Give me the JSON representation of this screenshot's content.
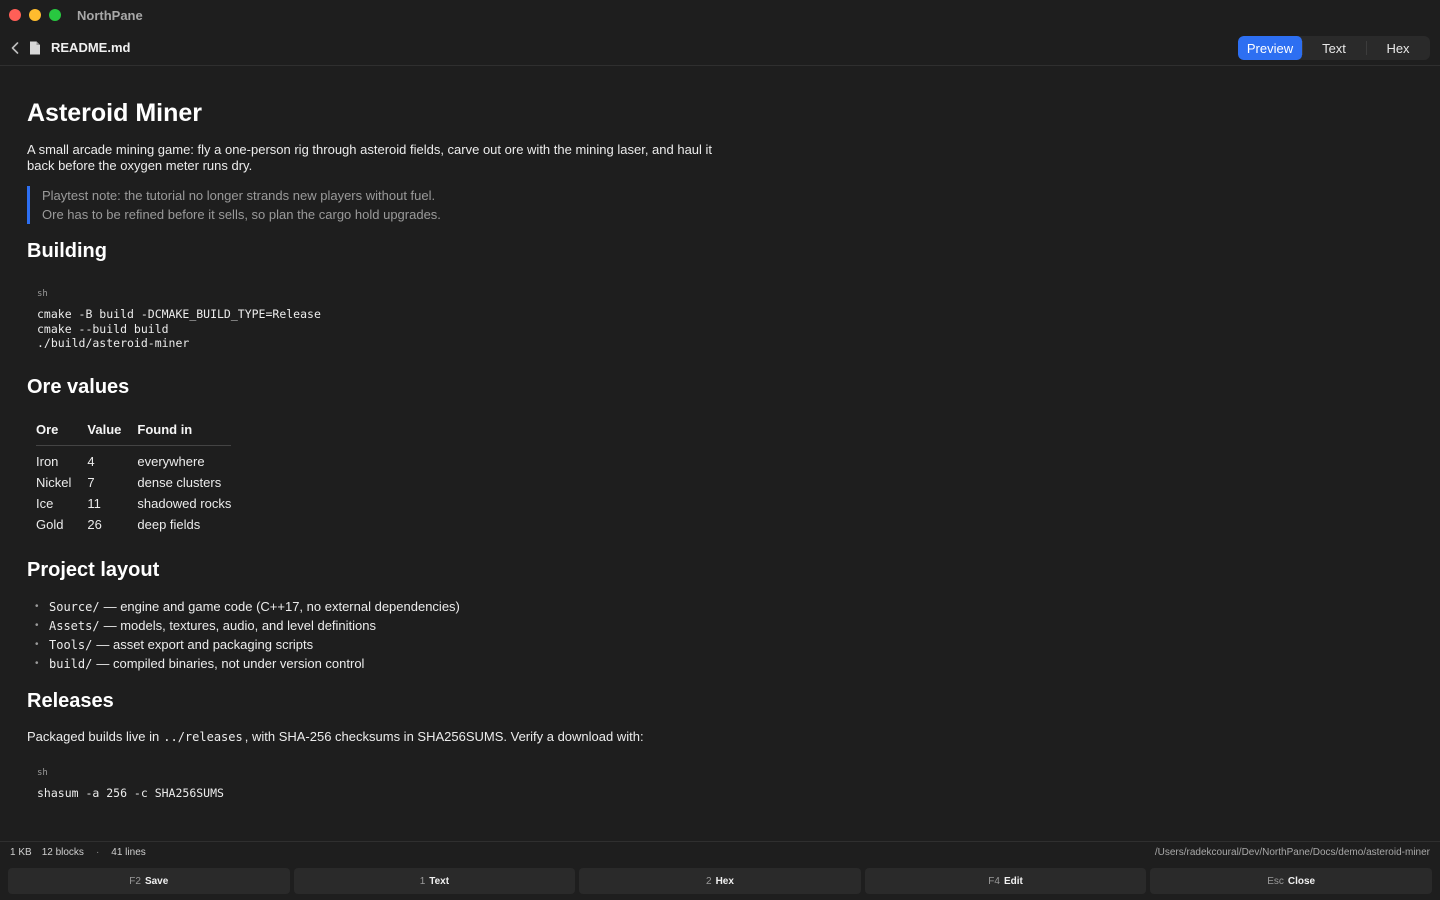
{
  "app": {
    "title": "NorthPane"
  },
  "toolbar": {
    "filename": "README.md",
    "views": [
      {
        "label": "Preview",
        "active": true
      },
      {
        "label": "Text",
        "active": false
      },
      {
        "label": "Hex",
        "active": false
      }
    ]
  },
  "doc": {
    "title": "Asteroid Miner",
    "intro": "A small arcade mining game: fly a one-person rig through asteroid fields, carve out ore with the mining laser, and haul it back before the oxygen meter runs dry.",
    "quote": [
      "Playtest note: the tutorial no longer strands new players without fuel.",
      "Ore has to be refined before it sells, so plan the cargo hold upgrades."
    ],
    "building": {
      "heading": "Building",
      "code_lang": "sh",
      "code": [
        "cmake -B build -DCMAKE_BUILD_TYPE=Release",
        "cmake --build build",
        "./build/asteroid-miner"
      ]
    },
    "ore": {
      "heading": "Ore values",
      "columns": [
        "Ore",
        "Value",
        "Found in"
      ],
      "rows": [
        [
          "Iron",
          "4",
          "everywhere"
        ],
        [
          "Nickel",
          "7",
          "dense clusters"
        ],
        [
          "Ice",
          "11",
          "shadowed rocks"
        ],
        [
          "Gold",
          "26",
          "deep fields"
        ]
      ]
    },
    "layout": {
      "heading": "Project layout",
      "items": [
        {
          "code": "Source/",
          "text": "— engine and game code (C++17, no external dependencies)"
        },
        {
          "code": "Assets/",
          "text": "— models, textures, audio, and level definitions"
        },
        {
          "code": "Tools/",
          "text": "— asset export and packaging scripts"
        },
        {
          "code": "build/",
          "text": "— compiled binaries, not under version control"
        }
      ]
    },
    "releases": {
      "heading": "Releases",
      "text_before": "Packaged builds live in",
      "code": "../releases",
      "text_after": ", with SHA-256 checksums in SHA256SUMS. Verify a download with:",
      "code_lang": "sh",
      "command": "shasum -a 256 -c SHA256SUMS"
    }
  },
  "status": {
    "size": "1 KB",
    "blocks": "12 blocks",
    "separator": "·",
    "lines": "41 lines",
    "path": "/Users/radekcoural/Dev/NorthPane/Docs/demo/asteroid-miner"
  },
  "fkeys": [
    {
      "key": "F2",
      "label": "Save"
    },
    {
      "key": "1",
      "label": "Text"
    },
    {
      "key": "2",
      "label": "Hex"
    },
    {
      "key": "F4",
      "label": "Edit"
    },
    {
      "key": "Esc",
      "label": "Close"
    }
  ],
  "colors": {
    "accent": "#2d6ff2",
    "background": "#1e1e1e",
    "traffic_close": "#ff5f57",
    "traffic_minimize": "#febc2e",
    "traffic_maximize": "#28c840"
  }
}
